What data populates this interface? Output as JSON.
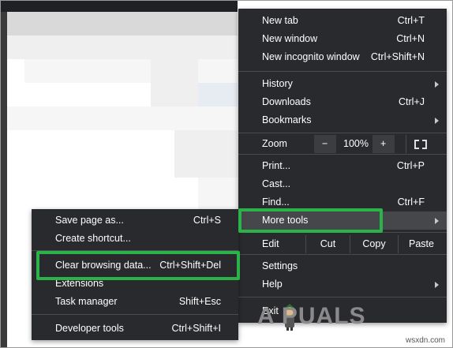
{
  "main_menu": {
    "new_tab": {
      "label": "New tab",
      "shortcut": "Ctrl+T"
    },
    "new_window": {
      "label": "New window",
      "shortcut": "Ctrl+N"
    },
    "new_incognito": {
      "label": "New incognito window",
      "shortcut": "Ctrl+Shift+N"
    },
    "history": {
      "label": "History"
    },
    "downloads": {
      "label": "Downloads",
      "shortcut": "Ctrl+J"
    },
    "bookmarks": {
      "label": "Bookmarks"
    },
    "zoom": {
      "label": "Zoom",
      "minus": "−",
      "level": "100%",
      "plus": "+"
    },
    "print": {
      "label": "Print...",
      "shortcut": "Ctrl+P"
    },
    "cast": {
      "label": "Cast..."
    },
    "find": {
      "label": "Find...",
      "shortcut": "Ctrl+F"
    },
    "more_tools": {
      "label": "More tools"
    },
    "edit": {
      "label": "Edit",
      "cut": "Cut",
      "copy": "Copy",
      "paste": "Paste"
    },
    "settings": {
      "label": "Settings"
    },
    "help": {
      "label": "Help"
    },
    "exit": {
      "label": "Exit"
    }
  },
  "sub_menu": {
    "save_page": {
      "label": "Save page as...",
      "shortcut": "Ctrl+S"
    },
    "create_shortcut": {
      "label": "Create shortcut..."
    },
    "clear_browsing": {
      "label": "Clear browsing data...",
      "shortcut": "Ctrl+Shift+Del"
    },
    "extensions": {
      "label": "Extensions"
    },
    "task_manager": {
      "label": "Task manager",
      "shortcut": "Shift+Esc"
    },
    "developer_tools": {
      "label": "Developer tools",
      "shortcut": "Ctrl+Shift+I"
    }
  },
  "watermark": {
    "brand": "A  PUALS",
    "site": "wsxdn.com"
  },
  "colors": {
    "menu_bg": "#292a2d",
    "highlight": "#2bb34a"
  }
}
